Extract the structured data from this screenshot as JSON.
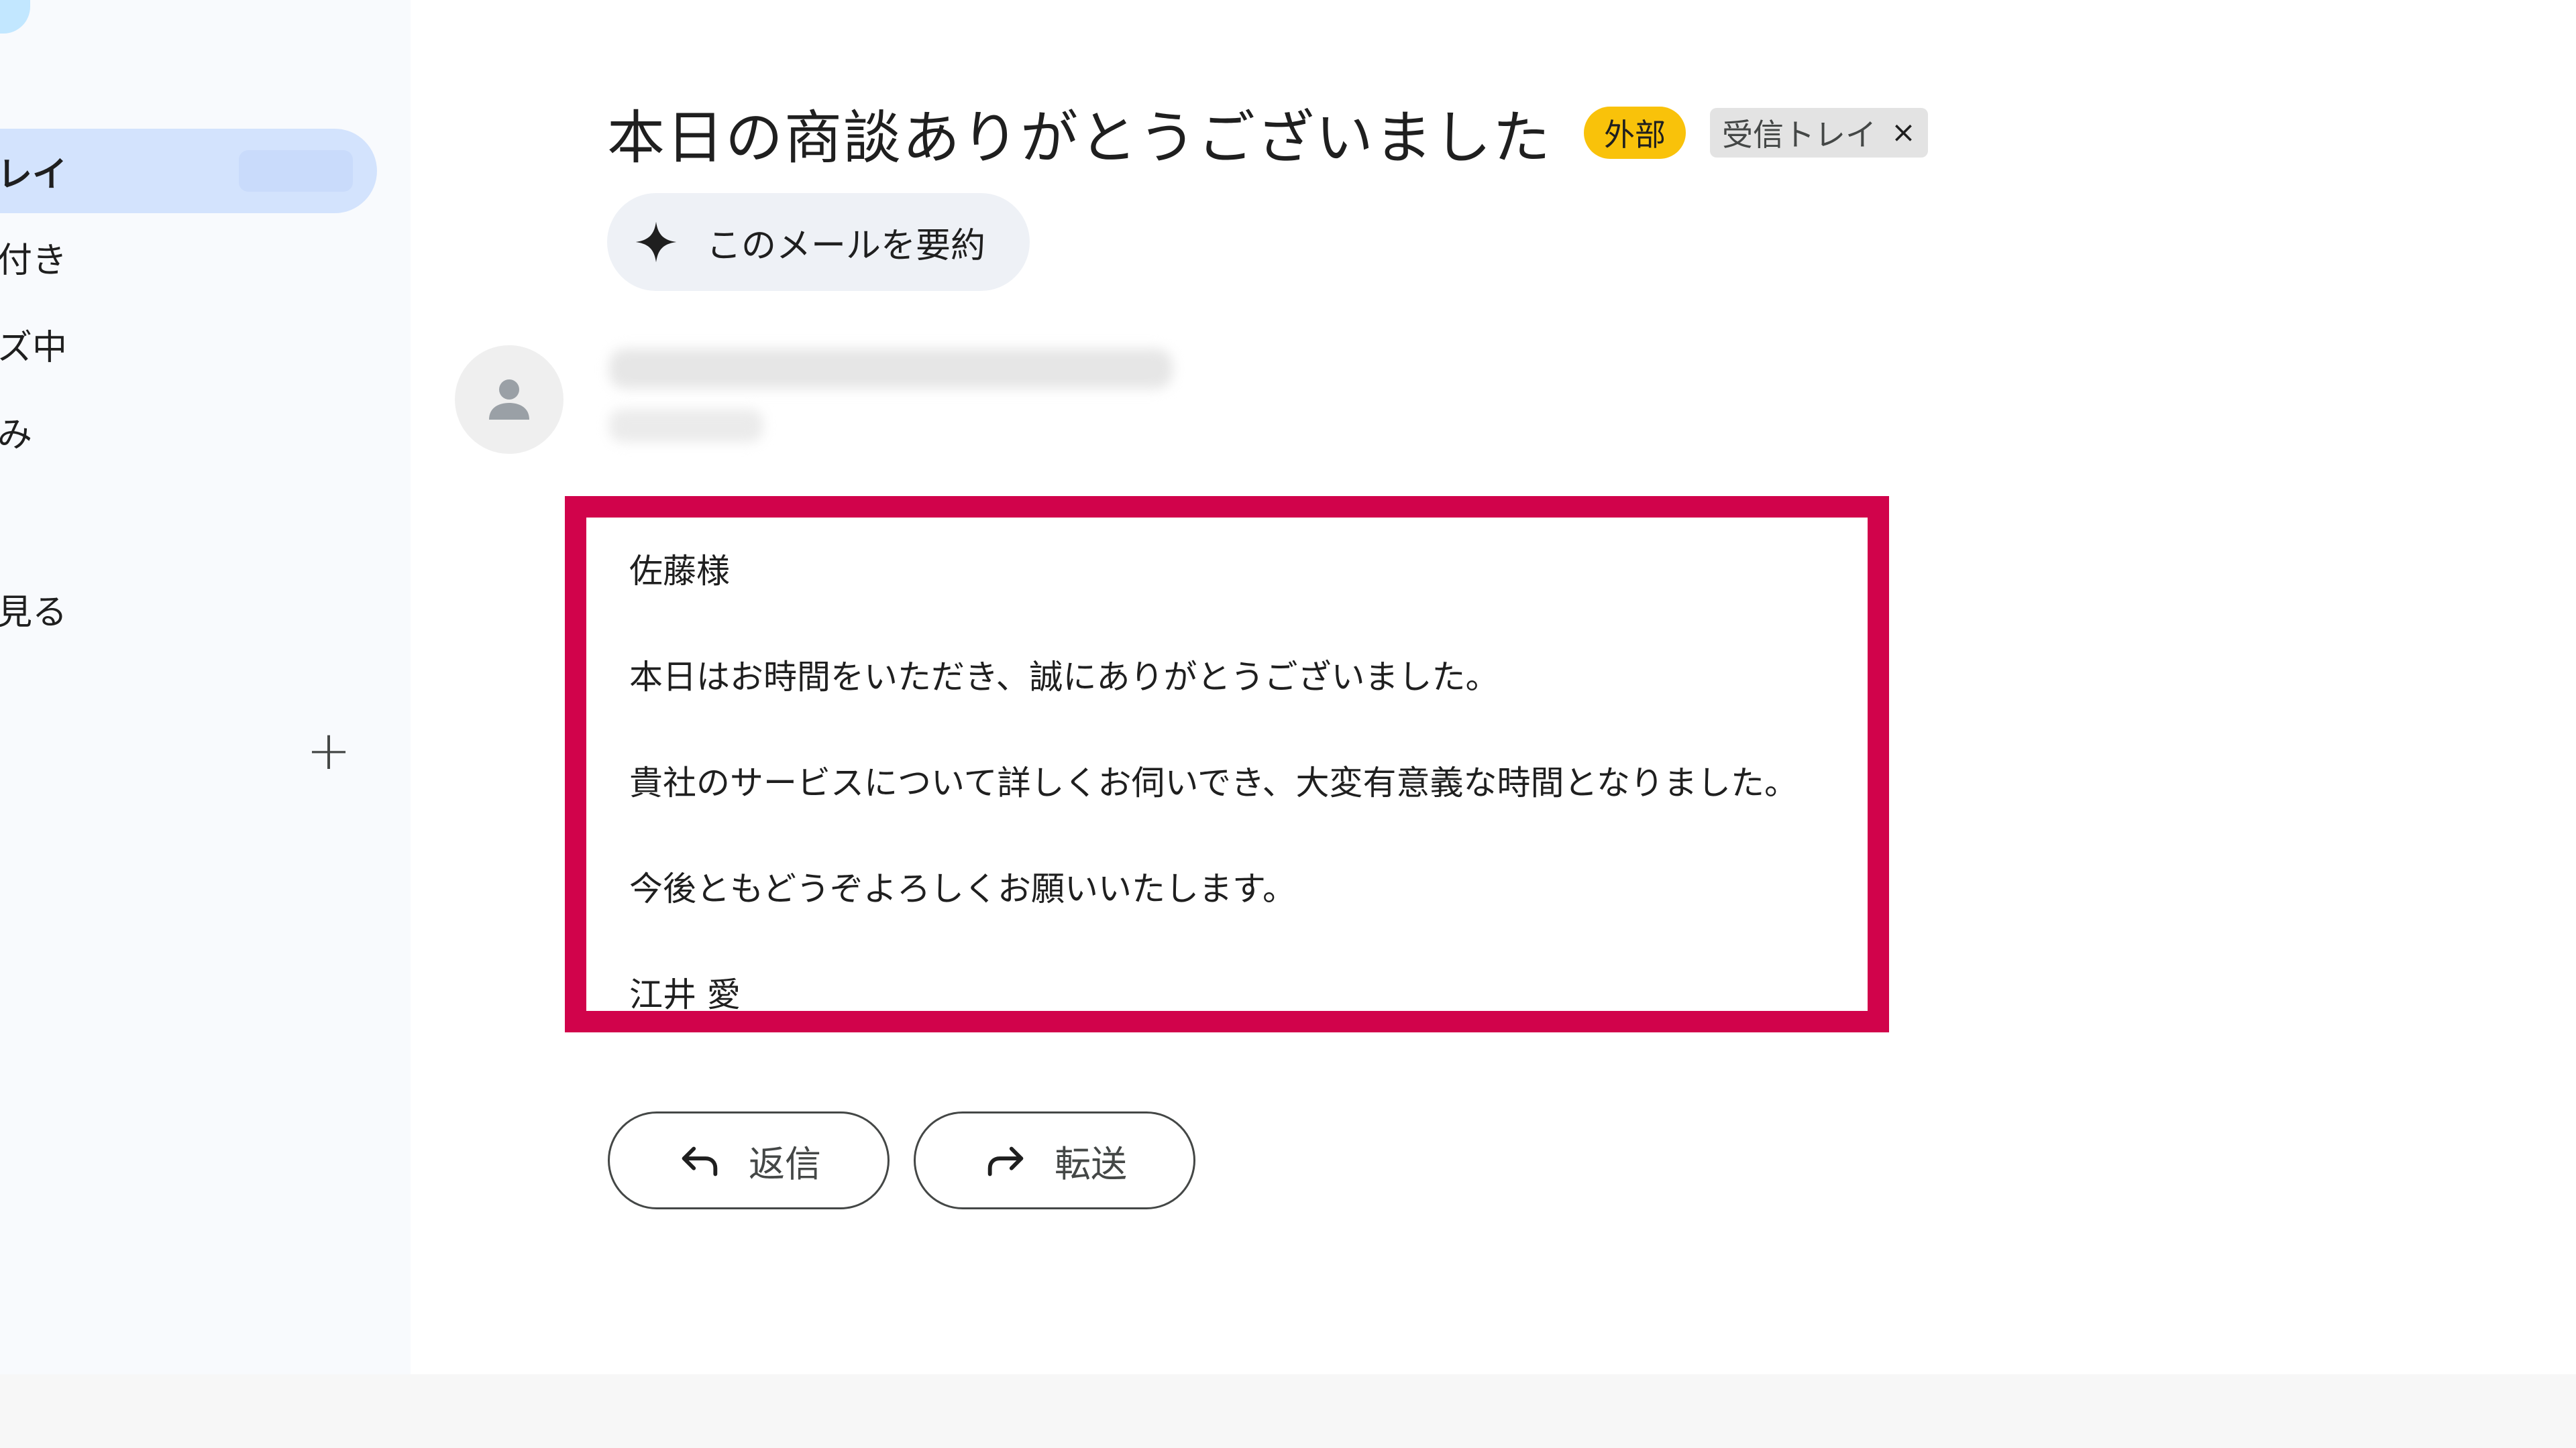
{
  "sidebar": {
    "items": [
      {
        "label": "レイ",
        "icon": "inbox-icon"
      },
      {
        "label": "付き",
        "icon": "star-icon"
      },
      {
        "label": "ズ中",
        "icon": "clock-icon"
      },
      {
        "label": "み",
        "icon": "send-icon"
      },
      {
        "label": "見る",
        "icon": "chevron-down-icon"
      }
    ],
    "labels_add_icon": "+"
  },
  "email": {
    "subject": "本日の商談ありがとうございました",
    "tags": {
      "external": "外部",
      "inbox": "受信トレイ",
      "inbox_remove": "×"
    },
    "summarize_label": "このメールを要約",
    "body": [
      "佐藤様",
      "本日はお時間をいただき、誠にありがとうございました。",
      "貴社のサービスについて詳しくお伺いでき、大変有意義な時間となりました。",
      "今後ともどうぞよろしくお願いいたします。",
      "江井 愛"
    ]
  },
  "actions": {
    "reply_label": "返信",
    "forward_label": "転送"
  },
  "colors": {
    "highlight_border": "#d1034b",
    "external_tag": "#f9c20a",
    "active_nav": "#d3e3fd",
    "sidebar_bg": "#f8fafd"
  }
}
